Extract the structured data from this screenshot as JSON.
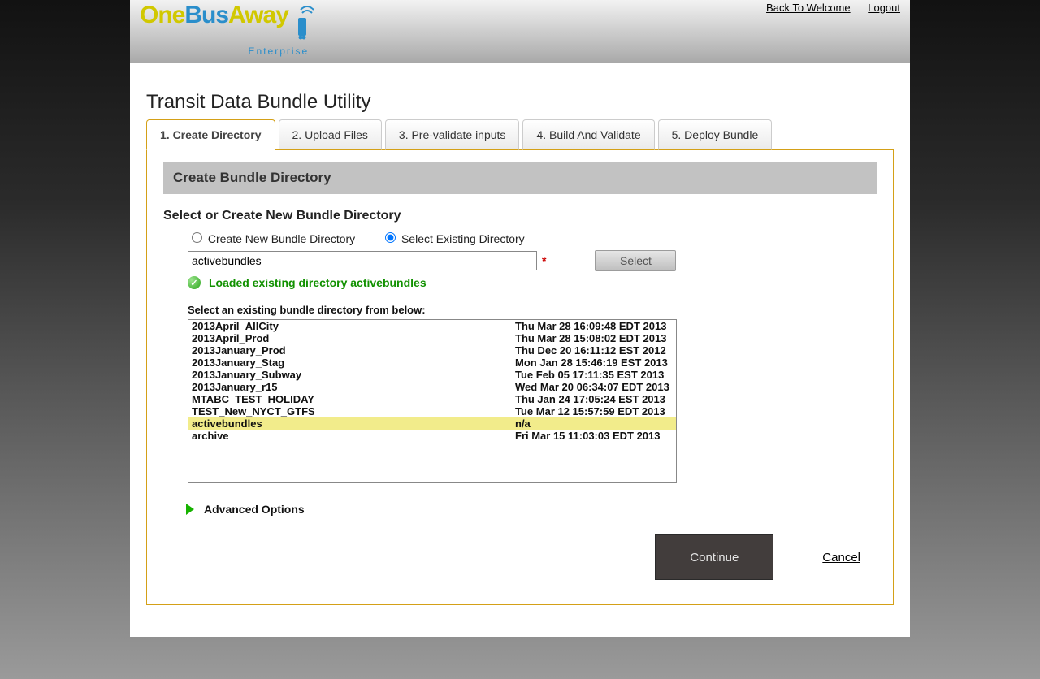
{
  "header": {
    "links": {
      "back": "Back To Welcome",
      "logout": "Logout"
    },
    "logo": {
      "one": "One",
      "bus": "Bus",
      "away": "Away",
      "sub": "Enterprise"
    }
  },
  "page_title": "Transit Data Bundle Utility",
  "tabs": [
    {
      "label": "1. Create Directory"
    },
    {
      "label": "2. Upload Files"
    },
    {
      "label": "3. Pre-validate inputs"
    },
    {
      "label": "4. Build And Validate"
    },
    {
      "label": "5. Deploy Bundle"
    }
  ],
  "panel": {
    "header": "Create Bundle Directory",
    "subheading": "Select or Create New Bundle Directory",
    "radios": {
      "create": "Create New Bundle Directory",
      "select": "Select Existing Directory"
    },
    "directory_value": "activebundles",
    "select_button": "Select",
    "status_message": "Loaded existing directory activebundles",
    "list_label": "Select an existing bundle directory from below:",
    "directories": [
      {
        "name": "2013April_AllCity",
        "date": "Thu Mar 28 16:09:48 EDT 2013"
      },
      {
        "name": "2013April_Prod",
        "date": "Thu Mar 28 15:08:02 EDT 2013"
      },
      {
        "name": "2013January_Prod",
        "date": "Thu Dec 20 16:11:12 EST 2012"
      },
      {
        "name": "2013January_Stag",
        "date": "Mon Jan 28 15:46:19 EST 2013"
      },
      {
        "name": "2013January_Subway",
        "date": "Tue Feb 05 17:11:35 EST 2013"
      },
      {
        "name": "2013January_r15",
        "date": "Wed Mar 20 06:34:07 EDT 2013"
      },
      {
        "name": "MTABC_TEST_HOLIDAY",
        "date": "Thu Jan 24 17:05:24 EST 2013"
      },
      {
        "name": "TEST_New_NYCT_GTFS",
        "date": "Tue Mar 12 15:57:59 EDT 2013"
      },
      {
        "name": "activebundles",
        "date": "n/a",
        "selected": true
      },
      {
        "name": "archive",
        "date": "Fri Mar 15 11:03:03 EDT 2013"
      }
    ],
    "advanced": "Advanced Options",
    "continue": "Continue",
    "cancel": "Cancel"
  }
}
